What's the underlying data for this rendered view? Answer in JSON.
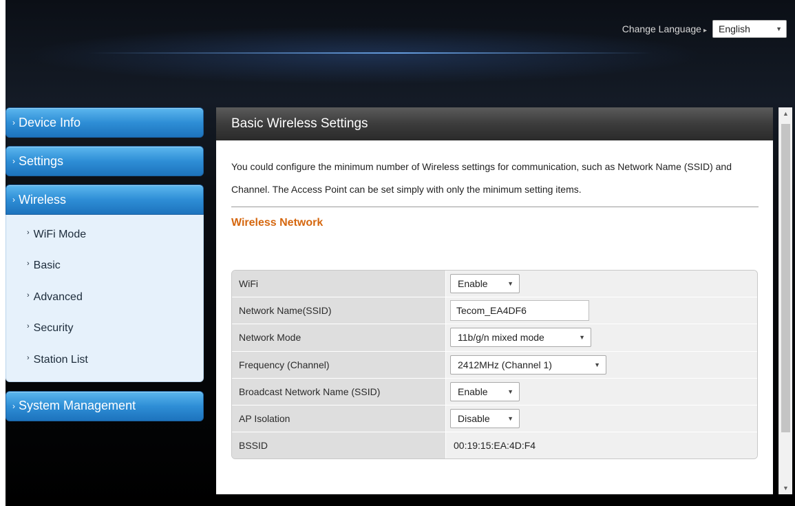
{
  "header": {
    "change_language_label": "Change Language",
    "language_selected": "English"
  },
  "sidebar": {
    "items": [
      {
        "label": "Device Info"
      },
      {
        "label": "Settings"
      },
      {
        "label": "Wireless"
      },
      {
        "label": "System Management"
      }
    ],
    "wireless_submenu": [
      {
        "label": "WiFi Mode"
      },
      {
        "label": "Basic"
      },
      {
        "label": "Advanced"
      },
      {
        "label": "Security"
      },
      {
        "label": "Station List"
      }
    ]
  },
  "main": {
    "title": "Basic Wireless Settings",
    "description": "You could configure the minimum number of Wireless settings for communication, such as Network Name (SSID) and Channel. The Access Point can be set simply with only the minimum setting items.",
    "section_title": "Wireless Network",
    "rows": [
      {
        "label": "WiFi",
        "value": "Enable"
      },
      {
        "label": "Network Name(SSID)",
        "value": "Tecom_EA4DF6"
      },
      {
        "label": "Network Mode",
        "value": "11b/g/n mixed mode"
      },
      {
        "label": "Frequency (Channel)",
        "value": "2412MHz (Channel 1)"
      },
      {
        "label": "Broadcast Network Name (SSID)",
        "value": "Enable"
      },
      {
        "label": "AP Isolation",
        "value": "Disable"
      },
      {
        "label": "BSSID",
        "value": "00:19:15:EA:4D:F4"
      }
    ]
  },
  "colors": {
    "accent_blue": "#2e8ed6",
    "section_title_orange": "#d5670f",
    "panel_header_dark": "#3c3c3c"
  }
}
